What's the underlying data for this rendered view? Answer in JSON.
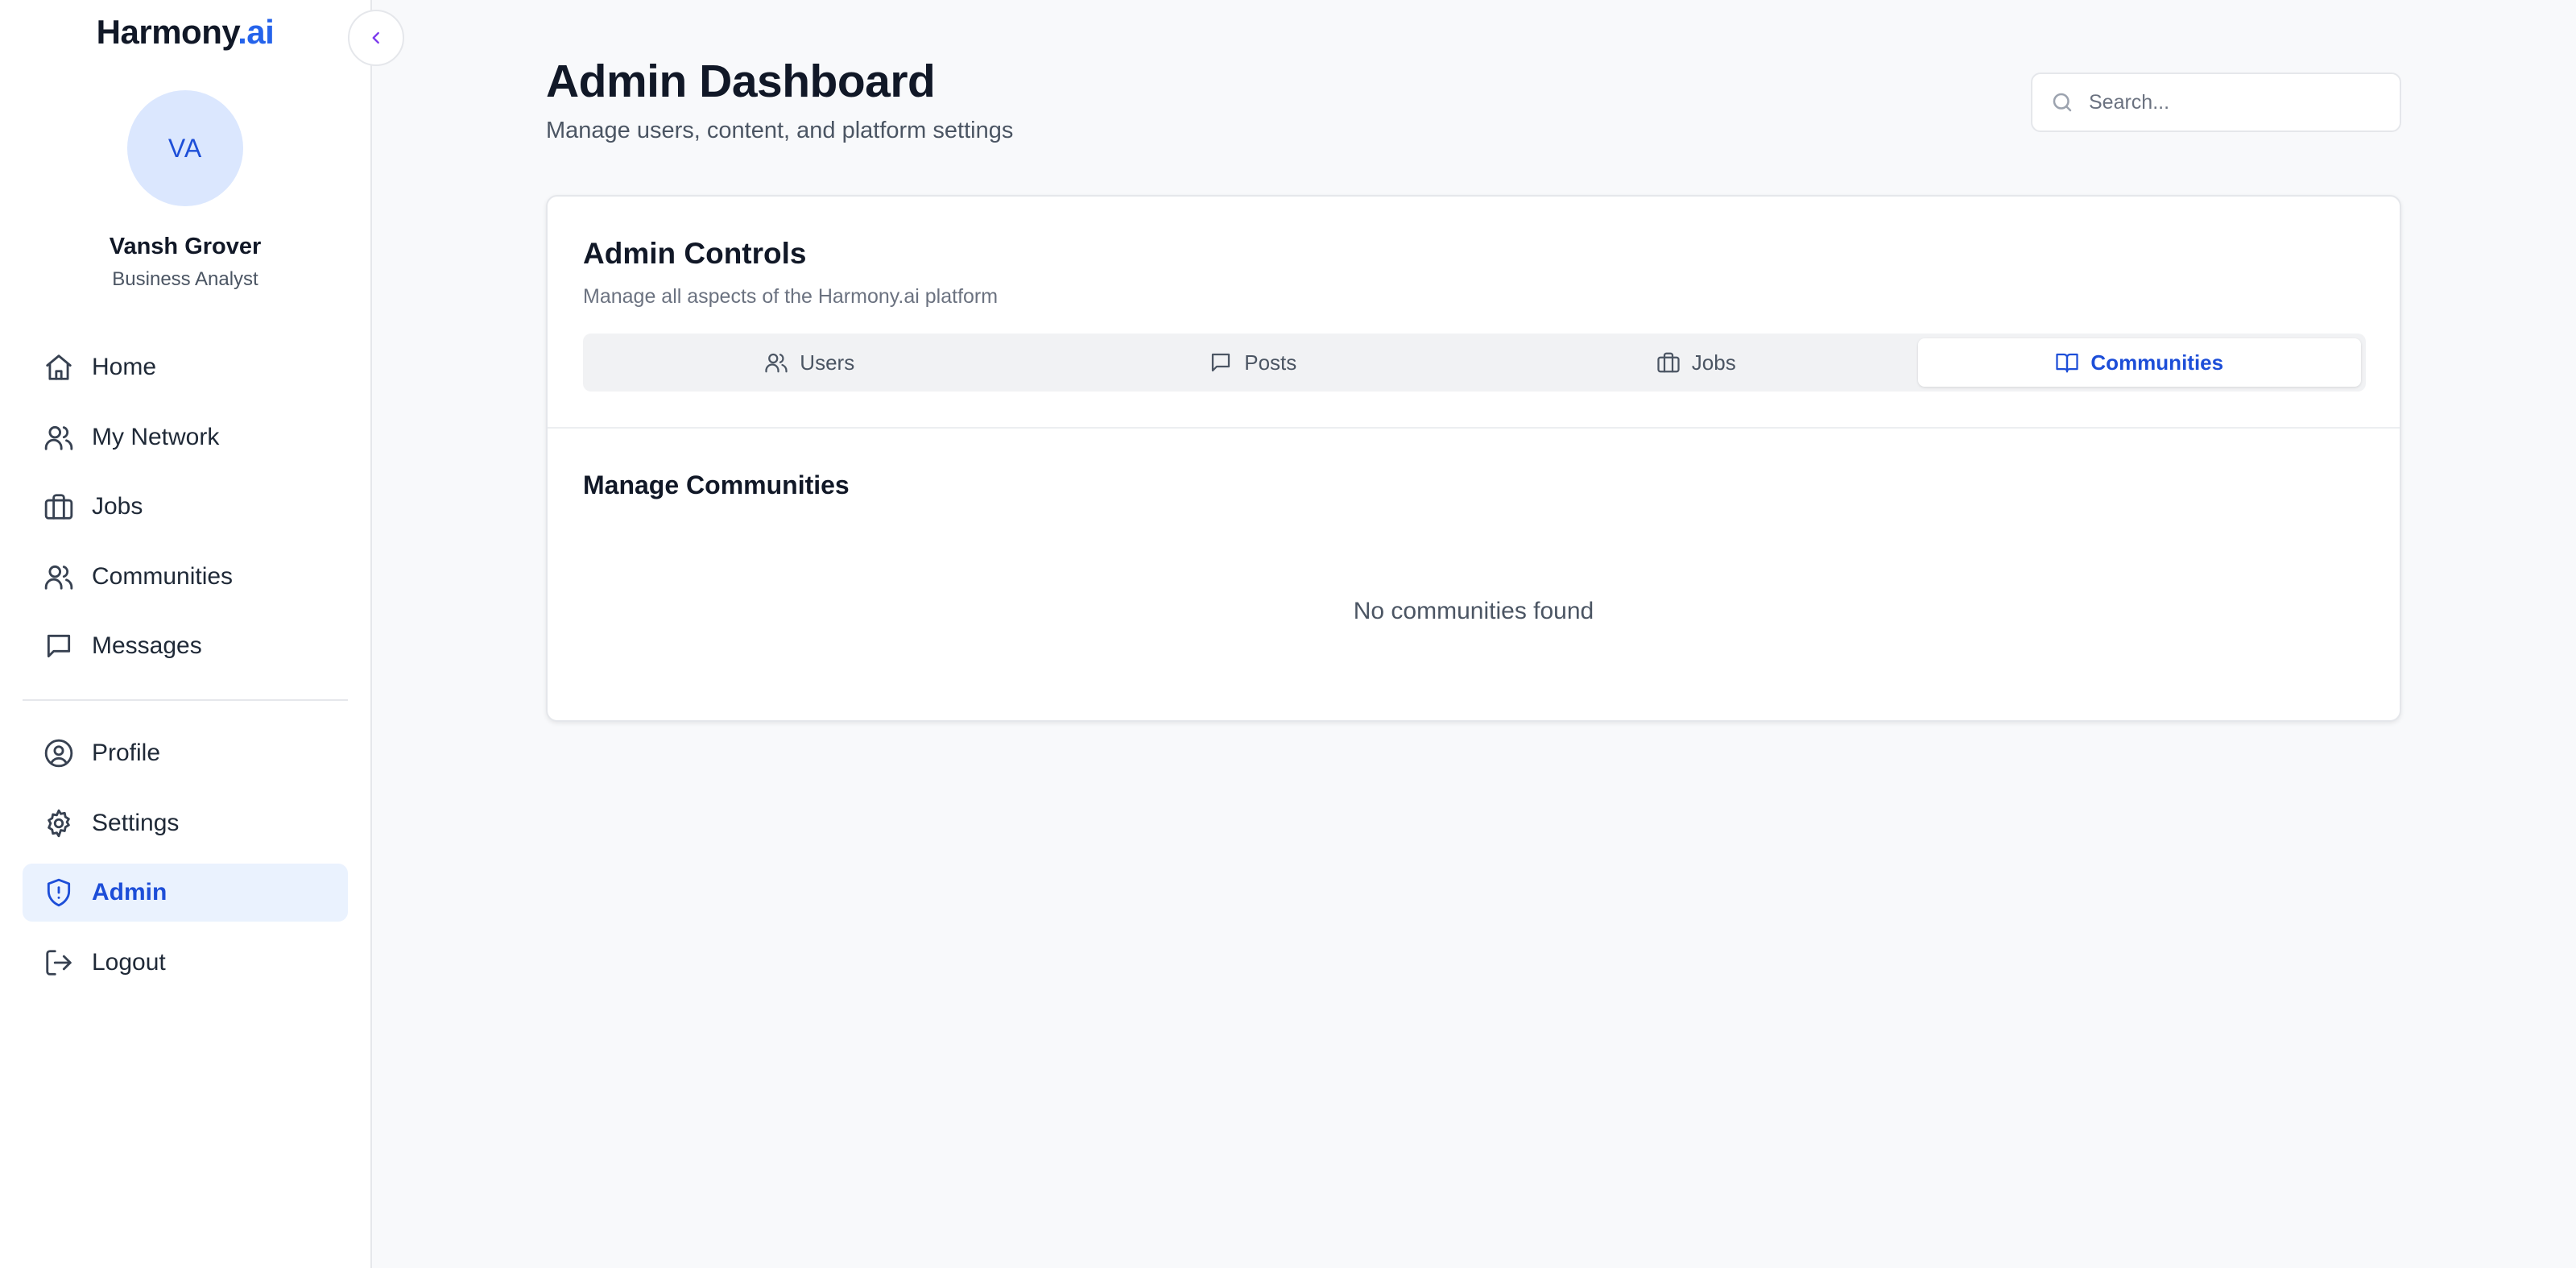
{
  "brand": {
    "name": "Harmony",
    "accent": ".ai",
    "accent_color": "#2563eb"
  },
  "user": {
    "initials": "VA",
    "name": "Vansh Grover",
    "role": "Business Analyst"
  },
  "sidebar": {
    "primary_items": [
      {
        "label": "Home",
        "icon": "home-icon"
      },
      {
        "label": "My Network",
        "icon": "users-icon"
      },
      {
        "label": "Jobs",
        "icon": "briefcase-icon"
      },
      {
        "label": "Communities",
        "icon": "users-icon"
      },
      {
        "label": "Messages",
        "icon": "message-square-icon"
      }
    ],
    "secondary_items": [
      {
        "label": "Profile",
        "icon": "user-circle-icon"
      },
      {
        "label": "Settings",
        "icon": "gear-icon"
      },
      {
        "label": "Admin",
        "icon": "shield-icon",
        "active": true
      },
      {
        "label": "Logout",
        "icon": "logout-icon"
      }
    ],
    "collapse_icon": "chevron-left-icon"
  },
  "header": {
    "title": "Admin Dashboard",
    "subtitle": "Manage users, content, and platform settings"
  },
  "search": {
    "placeholder": "Search...",
    "value": "",
    "icon": "search-icon"
  },
  "admin_controls": {
    "title": "Admin Controls",
    "description": "Manage all aspects of the Harmony.ai platform",
    "tabs": [
      {
        "label": "Users",
        "icon": "users-icon"
      },
      {
        "label": "Posts",
        "icon": "message-square-icon"
      },
      {
        "label": "Jobs",
        "icon": "briefcase-icon"
      },
      {
        "label": "Communities",
        "icon": "book-open-icon",
        "active": true
      }
    ],
    "section_title": "Manage Communities",
    "empty_message": "No communities found"
  },
  "colors": {
    "active_text": "#1d4ed8",
    "active_bg": "#eaf2fe",
    "avatar_bg": "#dbe7fe",
    "page_bg": "#f8f9fb"
  }
}
